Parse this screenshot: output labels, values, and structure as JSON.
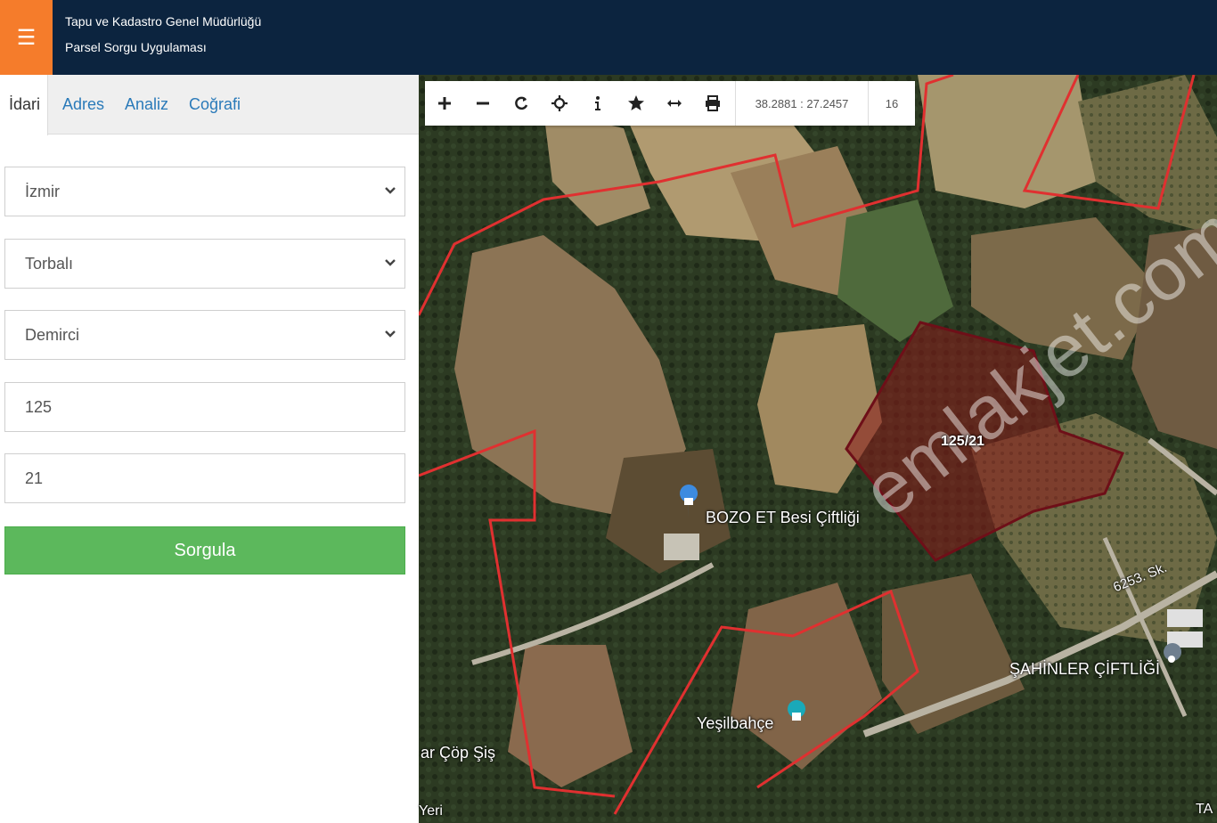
{
  "header": {
    "menu_icon": "hamburger-icon",
    "org_title": "Tapu ve Kadastro Genel Müdürlüğü",
    "app_title": "Parsel Sorgu Uygulaması",
    "colors": {
      "bar": "#0c243f",
      "menu": "#f57c2b"
    }
  },
  "tabs": [
    {
      "label": "İdari",
      "active": true
    },
    {
      "label": "Adres",
      "active": false
    },
    {
      "label": "Analiz",
      "active": false
    },
    {
      "label": "Coğrafi",
      "active": false
    }
  ],
  "form": {
    "il": "İzmir",
    "ilce": "Torbalı",
    "mahalle": "Demirci",
    "ada": "125",
    "parsel": "21",
    "submit_label": "Sorgula",
    "submit_color": "#5cb85c"
  },
  "toolbar": {
    "tools": [
      "zoom-in-icon",
      "zoom-out-icon",
      "refresh-icon",
      "locate-icon",
      "info-icon",
      "star-icon",
      "measure-icon",
      "print-icon"
    ],
    "coordinates": "38.2881 : 27.2457",
    "zoom_level": "16"
  },
  "map": {
    "parcel_label": "125/21",
    "places": {
      "farm": "BOZO ET Besi Çiftliği",
      "village": "Yeşilbahçe",
      "sahinler": "ŞAHİNLER ÇİFTLİĞİ",
      "street": "6253. Sk.",
      "cop": "ar Çöp Şiş",
      "eri": "Yeri",
      "ta": "TA"
    },
    "watermark": "emlakjet.com",
    "parcel_color": "#8b1a1a"
  }
}
